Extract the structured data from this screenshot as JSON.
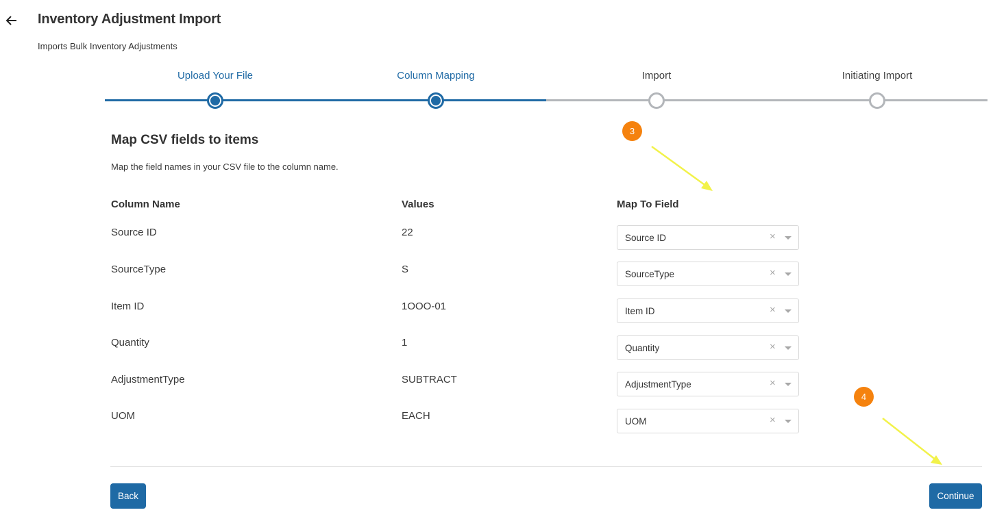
{
  "header": {
    "title": "Inventory Adjustment Import",
    "subtitle": "Imports Bulk Inventory Adjustments",
    "back_icon": "arrow-left-icon"
  },
  "stepper": {
    "steps": [
      {
        "label": "Upload Your File",
        "state": "done"
      },
      {
        "label": "Column Mapping",
        "state": "done"
      },
      {
        "label": "Import",
        "state": "todo"
      },
      {
        "label": "Initiating Import",
        "state": "todo"
      }
    ]
  },
  "section": {
    "title": "Map CSV fields to items",
    "description": "Map the field names in your CSV file to the column name."
  },
  "table": {
    "headers": {
      "column_name": "Column Name",
      "values": "Values",
      "map_to_field": "Map To Field"
    },
    "rows": [
      {
        "column": "Source ID",
        "value": "22",
        "mapped": "Source ID"
      },
      {
        "column": "SourceType",
        "value": "S",
        "mapped": "SourceType"
      },
      {
        "column": "Item ID",
        "value": "1OOO-01",
        "mapped": "Item ID"
      },
      {
        "column": "Quantity",
        "value": "1",
        "mapped": "Quantity"
      },
      {
        "column": "AdjustmentType",
        "value": "SUBTRACT",
        "mapped": "AdjustmentType"
      },
      {
        "column": "UOM",
        "value": "EACH",
        "mapped": "UOM"
      }
    ],
    "clear_glyph": "×"
  },
  "footer": {
    "back_label": "Back",
    "continue_label": "Continue"
  },
  "annotations": [
    {
      "label": "3"
    },
    {
      "label": "4"
    }
  ],
  "colors": {
    "primary": "#1f6aa5",
    "inactive": "#b3b6ba",
    "badge": "#f5820e",
    "annotation_arrow": "#f2f24a"
  }
}
